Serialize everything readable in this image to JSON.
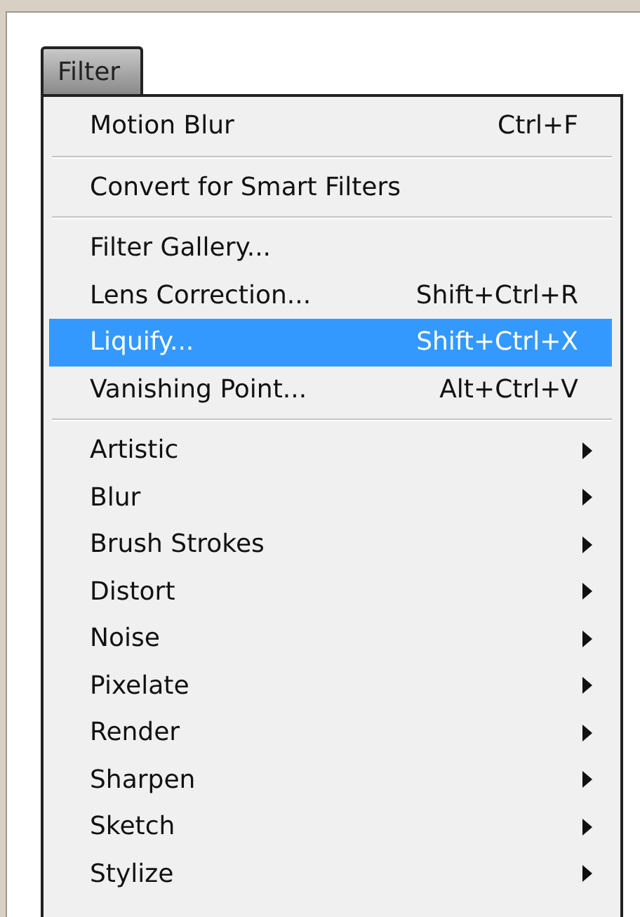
{
  "menu_title": "Filter",
  "groups": [
    {
      "items": [
        {
          "label": "Motion Blur",
          "shortcut": "Ctrl+F",
          "submenu": false,
          "selected": false
        }
      ]
    },
    {
      "items": [
        {
          "label": "Convert for Smart Filters",
          "submenu": false,
          "selected": false
        }
      ]
    },
    {
      "items": [
        {
          "label": "Filter Gallery...",
          "submenu": false,
          "selected": false
        },
        {
          "label": "Lens Correction...",
          "shortcut": "Shift+Ctrl+R",
          "submenu": false,
          "selected": false
        },
        {
          "label": "Liquify...",
          "shortcut": "Shift+Ctrl+X",
          "submenu": false,
          "selected": true
        },
        {
          "label": "Vanishing Point...",
          "shortcut": "Alt+Ctrl+V",
          "submenu": false,
          "selected": false
        }
      ]
    },
    {
      "items": [
        {
          "label": "Artistic",
          "submenu": true,
          "selected": false
        },
        {
          "label": "Blur",
          "submenu": true,
          "selected": false
        },
        {
          "label": "Brush Strokes",
          "submenu": true,
          "selected": false
        },
        {
          "label": "Distort",
          "submenu": true,
          "selected": false
        },
        {
          "label": "Noise",
          "submenu": true,
          "selected": false
        },
        {
          "label": "Pixelate",
          "submenu": true,
          "selected": false
        },
        {
          "label": "Render",
          "submenu": true,
          "selected": false
        },
        {
          "label": "Sharpen",
          "submenu": true,
          "selected": false
        },
        {
          "label": "Sketch",
          "submenu": true,
          "selected": false
        },
        {
          "label": "Stylize",
          "submenu": true,
          "selected": false
        }
      ]
    }
  ]
}
